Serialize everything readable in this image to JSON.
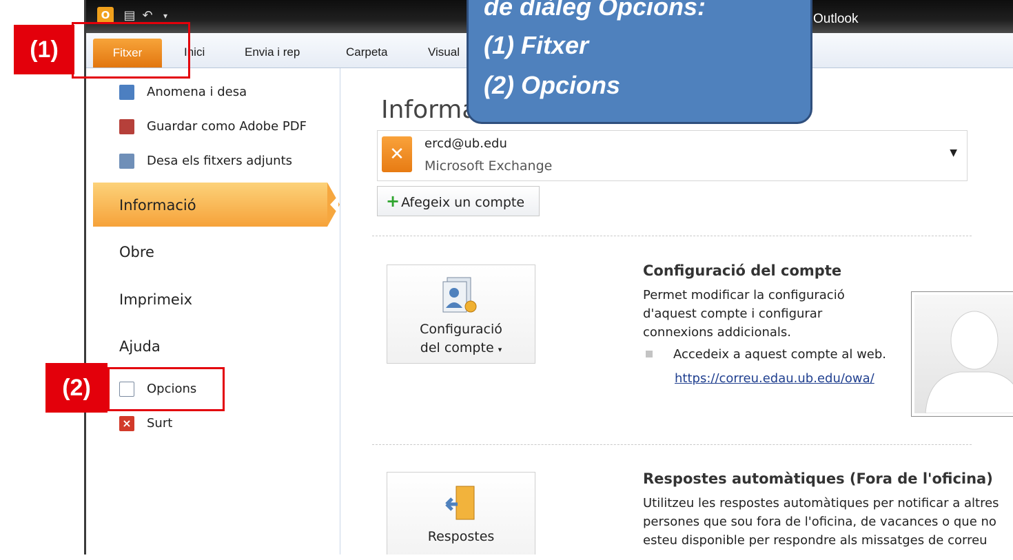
{
  "window": {
    "title": "Outlook"
  },
  "ribbon": {
    "tabs": [
      "Fitxer",
      "Inici",
      "Envia i rep",
      "Carpeta",
      "Visual"
    ]
  },
  "backstage": {
    "commands_top": [
      "Anomena i desa",
      "Guardar como Adobe PDF",
      "Desa els fitxers adjunts"
    ],
    "nav": [
      "Informació",
      "Obre",
      "Imprimeix",
      "Ajuda"
    ],
    "commands_bottom": [
      "Opcions",
      "Surt"
    ]
  },
  "content": {
    "title": "Informa",
    "account": {
      "email": "ercd@ub.edu",
      "type": "Microsoft Exchange"
    },
    "add_account_label": "Afegeix un compte",
    "account_settings": {
      "button_line1": "Configuració",
      "button_line2": "del compte",
      "heading": "Configuració del compte",
      "desc": [
        "Permet modificar la configuració",
        "d'aquest compte i configurar",
        "connexions addicionals."
      ],
      "bullet": "Accedeix a aquest compte al web.",
      "link": "https://correu.edau.ub.edu/owa/"
    },
    "auto_replies": {
      "button_label": "Respostes",
      "heading": "Respostes automàtiques (Fora de l'oficina)",
      "desc": [
        "Utilitzeu les respostes automàtiques per notificar a altres",
        "persones que sou fora de l'oficina, de vacances o que no",
        "esteu disponible per respondre als missatges de correu"
      ]
    }
  },
  "annotations": {
    "mark1": "(1)",
    "mark2": "(2)",
    "callout": [
      "de diàleg Opcions:",
      "(1) Fitxer",
      "(2) Opcions"
    ]
  }
}
